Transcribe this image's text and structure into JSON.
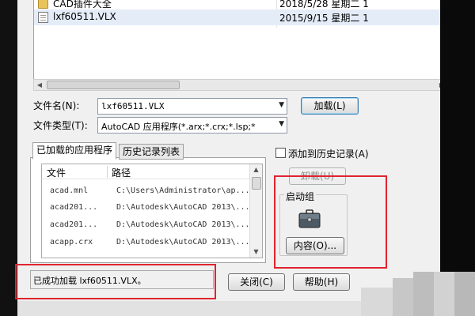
{
  "file_list": {
    "rows": [
      {
        "name": "CAD插件大全",
        "date": "2018/5/28 星期二 1",
        "type": "folder"
      },
      {
        "name": "lxf60511.VLX",
        "date": "2015/9/15 星期二 1",
        "type": "file"
      }
    ]
  },
  "form": {
    "filename_label": "文件名(N):",
    "filename_value": "lxf60511.VLX",
    "filetype_label": "文件类型(T):",
    "filetype_value": "AutoCAD 应用程序(*.arx;*.crx;*.lsp;*",
    "load_button": "加载(L)"
  },
  "tabs": {
    "loaded": "已加载的应用程序",
    "history": "历史记录列表"
  },
  "app_list": {
    "col_file": "文件",
    "col_path": "路径",
    "rows": [
      {
        "file": "acad.mnl",
        "path": "C:\\Users\\Administrator\\ap..."
      },
      {
        "file": "acad201...",
        "path": "D:\\Autodesk\\AutoCAD 2013\\..."
      },
      {
        "file": "acad201...",
        "path": "D:\\Autodesk\\AutoCAD 2013\\..."
      },
      {
        "file": "acapp.crx",
        "path": "D:\\Autodesk\\AutoCAD 2013\\..."
      }
    ]
  },
  "history_checkbox_label": "添加到历史记录(A)",
  "unload_button": "卸载(U)",
  "startup": {
    "title": "启动组",
    "contents_button": "内容(O)..."
  },
  "status_text": "已成功加载 lxf60511.VLX。",
  "close_button": "关闭(C)",
  "help_button": "帮助(H)",
  "colors": {
    "highlight": "#e0242f",
    "dialog_bg": "#f0f0f0"
  }
}
